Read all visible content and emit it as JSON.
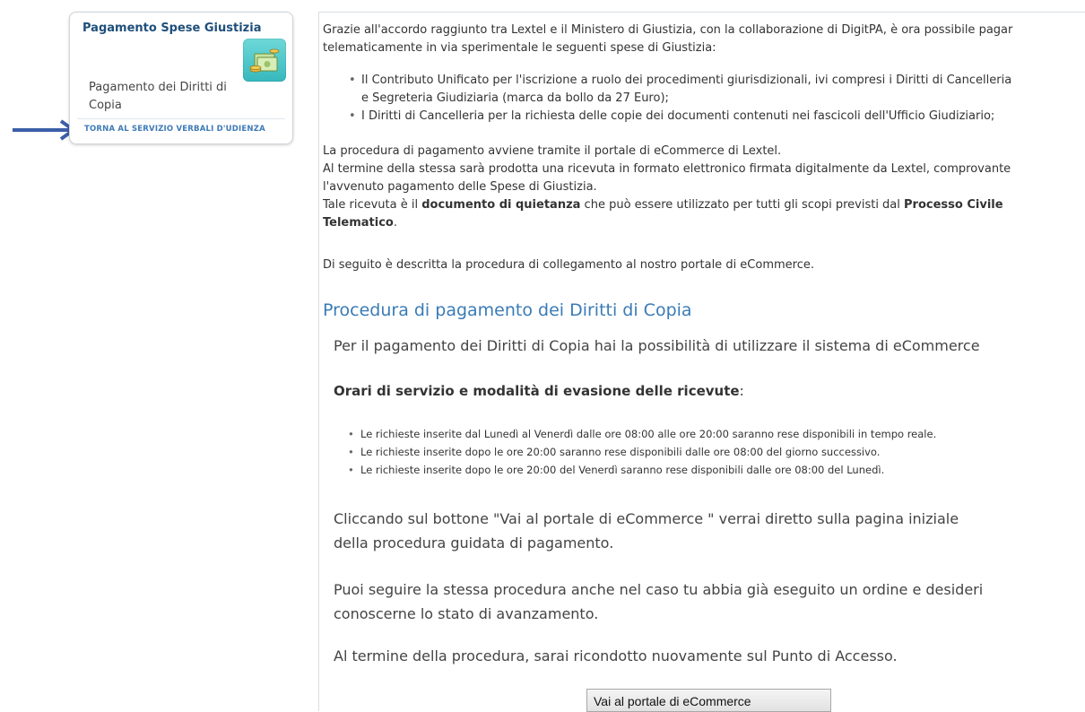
{
  "sidebar": {
    "title": "Pagamento Spese Giustizia",
    "link": "Pagamento dei Diritti di Copia",
    "return_link": "Torna al Servizio Verbali d'Udienza"
  },
  "main": {
    "intro_line1": "Grazie all'accordo raggiunto tra Lextel e il Ministero di Giustizia, con la collaborazione di DigitPA, è ora possibile pagar",
    "intro_line2": "telematicamente in via sperimentale le seguenti spese di Giustizia:",
    "bullet1_line1": "Il Contributo Unificato per l'iscrizione a ruolo dei procedimenti giurisdizionali, ivi compresi i Diritti di Cancelleria",
    "bullet1_line2": "e Segreteria Giudiziaria (marca da bollo da 27 Euro);",
    "bullet2": "I Diritti di Cancelleria per la richiesta delle copie dei documenti contenuti nei fascicoli dell'Ufficio Giudiziario;",
    "para1_line1": "La procedura di pagamento avviene tramite il portale di eCommerce di Lextel.",
    "para1_line2": "Al termine della stessa sarà prodotta una ricevuta in formato elettronico firmata digitalmente da Lextel, comprovante",
    "para1_line3": "l'avvenuto pagamento delle Spese di Giustizia.",
    "para1_line4_a": "Tale ricevuta è il ",
    "para1_line4_b": "documento di quietanza",
    "para1_line4_c": " che può essere utilizzato per tutti gli scopi previsti dal ",
    "para1_line4_d": "Processo Civile",
    "para1_line5_a": "Telematico",
    "para1_line5_b": ".",
    "para2": "Di seguito è descritta la procedura di collegamento al nostro portale di eCommerce."
  },
  "section": {
    "title": "Procedura di pagamento dei Diritti di Copia",
    "lead": "Per il pagamento dei Diritti di Copia hai la possibilità di utilizzare il sistema di eCommerce",
    "hours_title": "Orari di servizio e modalità di evasione delle ricevute",
    "hours_colon": ":",
    "hours": [
      "Le richieste inserite dal Lunedì al Venerdì dalle ore 08:00 alle ore 20:00 saranno rese disponibili in tempo reale.",
      "Le richieste inserite dopo le ore 20:00 saranno rese disponibili dalle ore 08:00 del giorno successivo.",
      "Le richieste inserite dopo le ore 20:00 del Venerdì saranno rese disponibili dalle ore 08:00 del Lunedì."
    ],
    "click_line1": "Cliccando sul bottone \"Vai al portale di eCommerce \" verrai diretto sulla pagina iniziale",
    "click_line2": "della procedura guidata di pagamento.",
    "follow_line1": "Puoi seguire la stessa procedura anche nel caso tu abbia già eseguito un ordine e desideri",
    "follow_line2": "conoscerne lo stato di avanzamento.",
    "end_line": "Al termine della procedura, sarai ricondotto nuovamente sul Punto di Accesso.",
    "button_label": "Vai al portale di eCommerce"
  },
  "colors": {
    "accent": "#3a7bb6",
    "sidebar_title": "#1f4f7a",
    "arrow": "#3b5ea8",
    "icon_bg": "#4cc6c8"
  },
  "icons": {
    "sidebar_icon": "money-icon",
    "pointer": "arrow-right-icon"
  }
}
